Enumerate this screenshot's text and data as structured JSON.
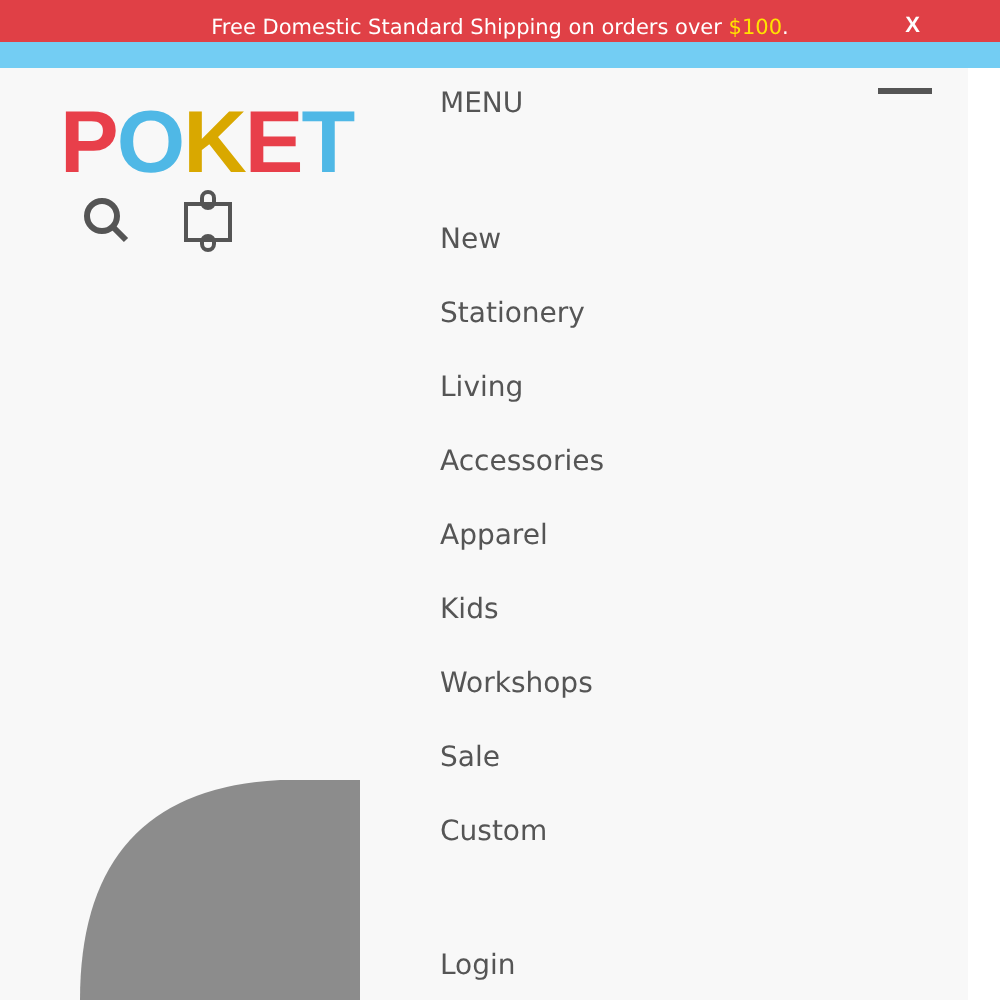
{
  "banner": {
    "message_start": "Free Domestic Standard Shipping on orders over ",
    "message_highlight": "$100",
    "message_end": ".",
    "close": "X"
  },
  "logo": {
    "text": "POKET"
  },
  "menu": {
    "title": "MENU",
    "items": [
      {
        "label": "New"
      },
      {
        "label": "Stationery"
      },
      {
        "label": "Living"
      },
      {
        "label": "Accessories"
      },
      {
        "label": "Apparel"
      },
      {
        "label": "Kids"
      },
      {
        "label": "Workshops"
      },
      {
        "label": "Sale"
      },
      {
        "label": "Custom"
      }
    ],
    "account": {
      "label": "Login"
    }
  }
}
